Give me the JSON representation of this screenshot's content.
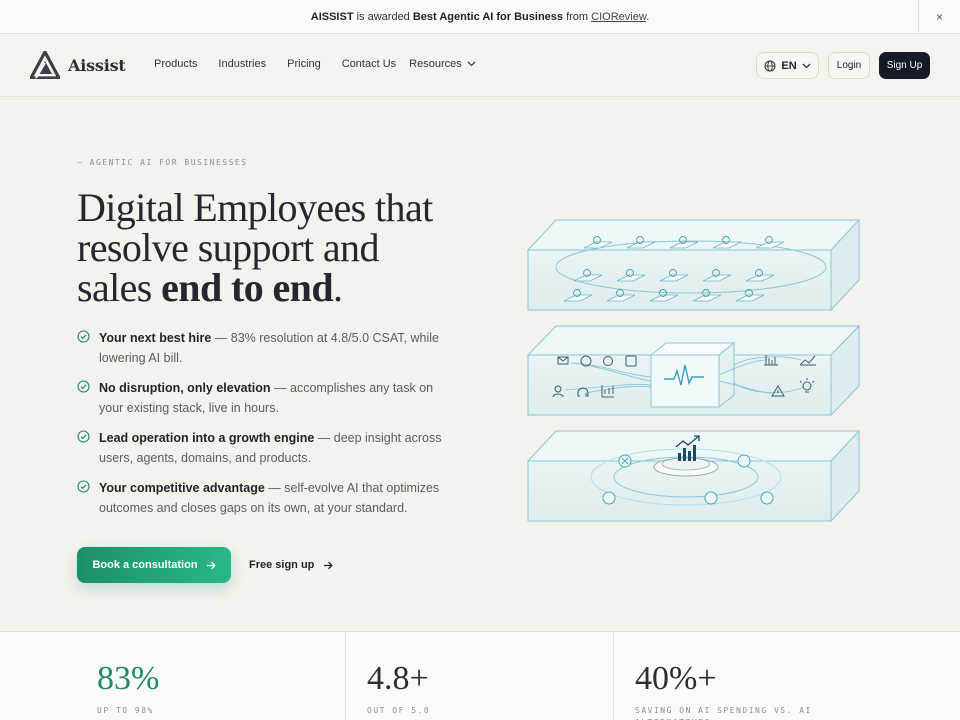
{
  "announcement": {
    "brand": "AISSIST",
    "text1": " is awarded ",
    "award": "Best Agentic AI for Business",
    "text2": " from ",
    "source": "CIOReview",
    "text3": ".",
    "close": "×"
  },
  "nav": {
    "logo_text": "Aissist",
    "links": [
      "Products",
      "Industries",
      "Pricing",
      "Contact Us"
    ],
    "resources": "Resources",
    "lang": "EN",
    "login": "Login",
    "signup": "Sign Up"
  },
  "hero": {
    "eyebrow": "— AGENTIC AI FOR BUSINESSES",
    "headline_line1": "Digital Employees that",
    "headline_line2": "resolve support and",
    "headline_line3_pre": "sales ",
    "headline_bold": "end to end",
    "headline_end": ".",
    "features": [
      {
        "title": "Your next best hire",
        "text": " — 83% resolution at 4.8/5.0 CSAT, while lowering AI bill."
      },
      {
        "title": "No disruption, only elevation",
        "text": " — accomplishes any task on your existing stack, live in hours."
      },
      {
        "title": "Lead operation into a growth engine",
        "text": " — deep insight across users, agents, domains, and products."
      },
      {
        "title": "Your competitive advantage",
        "text": " — self-evolve AI that optimizes outcomes and closes gaps on its own, at your standard."
      }
    ],
    "cta_primary": "Book a consultation",
    "cta_secondary": "Free sign up"
  },
  "stats": [
    {
      "value": "83%",
      "caption": "UP TO 98%"
    },
    {
      "value": "4.8+",
      "caption": "OUT OF 5.0"
    },
    {
      "value": "40%+",
      "caption": "SAVING ON AI SPENDING VS. AI ALTERNATIVES"
    }
  ],
  "colors": {
    "accent": "#1e8a68",
    "dark": "#141b27",
    "bg": "#f4f2ec",
    "illus": "#8cc6d4"
  }
}
